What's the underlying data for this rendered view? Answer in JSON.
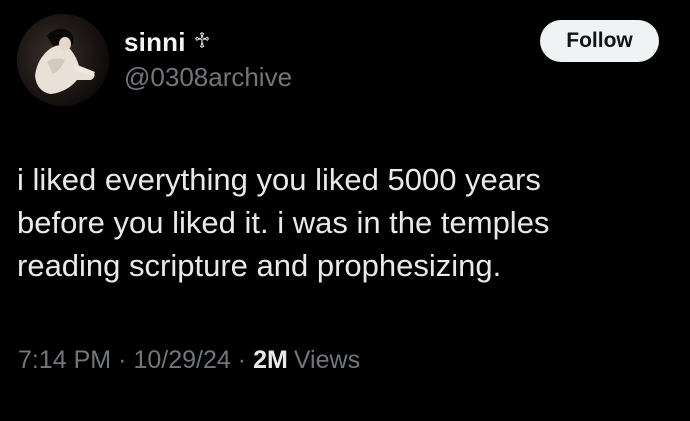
{
  "author": {
    "display_name": "sinni",
    "name_glyph": "♱",
    "handle": "@0308archive"
  },
  "follow_label": "Follow",
  "tweet": {
    "lines": [
      "i liked everything you liked 5000 years",
      "before you liked it. i was in the temples",
      "reading scripture and prophesizing."
    ]
  },
  "meta": {
    "time": "7:14 PM",
    "separator": "·",
    "date": "10/29/24",
    "views_count": "2M",
    "views_label": "Views"
  },
  "colors": {
    "background": "#000000",
    "text_primary": "#e7e9ea",
    "text_secondary": "#71767b",
    "button_bg": "#eff3f4",
    "button_text": "#0f1419"
  },
  "icons": {
    "avatar": "profile-photo"
  }
}
